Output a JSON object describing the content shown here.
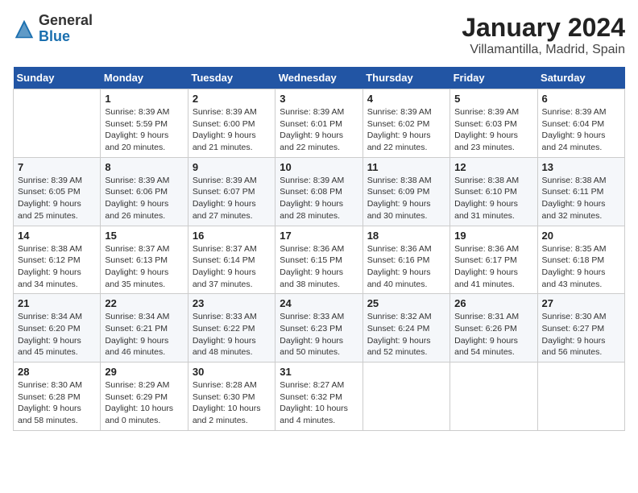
{
  "header": {
    "logo_general": "General",
    "logo_blue": "Blue",
    "month": "January 2024",
    "location": "Villamantilla, Madrid, Spain"
  },
  "weekdays": [
    "Sunday",
    "Monday",
    "Tuesday",
    "Wednesday",
    "Thursday",
    "Friday",
    "Saturday"
  ],
  "weeks": [
    [
      {
        "day": "",
        "empty": true
      },
      {
        "day": "1",
        "sunrise": "Sunrise: 8:39 AM",
        "sunset": "Sunset: 5:59 PM",
        "daylight": "Daylight: 9 hours and 20 minutes."
      },
      {
        "day": "2",
        "sunrise": "Sunrise: 8:39 AM",
        "sunset": "Sunset: 6:00 PM",
        "daylight": "Daylight: 9 hours and 21 minutes."
      },
      {
        "day": "3",
        "sunrise": "Sunrise: 8:39 AM",
        "sunset": "Sunset: 6:01 PM",
        "daylight": "Daylight: 9 hours and 22 minutes."
      },
      {
        "day": "4",
        "sunrise": "Sunrise: 8:39 AM",
        "sunset": "Sunset: 6:02 PM",
        "daylight": "Daylight: 9 hours and 22 minutes."
      },
      {
        "day": "5",
        "sunrise": "Sunrise: 8:39 AM",
        "sunset": "Sunset: 6:03 PM",
        "daylight": "Daylight: 9 hours and 23 minutes."
      },
      {
        "day": "6",
        "sunrise": "Sunrise: 8:39 AM",
        "sunset": "Sunset: 6:04 PM",
        "daylight": "Daylight: 9 hours and 24 minutes."
      }
    ],
    [
      {
        "day": "7",
        "sunrise": "Sunrise: 8:39 AM",
        "sunset": "Sunset: 6:05 PM",
        "daylight": "Daylight: 9 hours and 25 minutes."
      },
      {
        "day": "8",
        "sunrise": "Sunrise: 8:39 AM",
        "sunset": "Sunset: 6:06 PM",
        "daylight": "Daylight: 9 hours and 26 minutes."
      },
      {
        "day": "9",
        "sunrise": "Sunrise: 8:39 AM",
        "sunset": "Sunset: 6:07 PM",
        "daylight": "Daylight: 9 hours and 27 minutes."
      },
      {
        "day": "10",
        "sunrise": "Sunrise: 8:39 AM",
        "sunset": "Sunset: 6:08 PM",
        "daylight": "Daylight: 9 hours and 28 minutes."
      },
      {
        "day": "11",
        "sunrise": "Sunrise: 8:38 AM",
        "sunset": "Sunset: 6:09 PM",
        "daylight": "Daylight: 9 hours and 30 minutes."
      },
      {
        "day": "12",
        "sunrise": "Sunrise: 8:38 AM",
        "sunset": "Sunset: 6:10 PM",
        "daylight": "Daylight: 9 hours and 31 minutes."
      },
      {
        "day": "13",
        "sunrise": "Sunrise: 8:38 AM",
        "sunset": "Sunset: 6:11 PM",
        "daylight": "Daylight: 9 hours and 32 minutes."
      }
    ],
    [
      {
        "day": "14",
        "sunrise": "Sunrise: 8:38 AM",
        "sunset": "Sunset: 6:12 PM",
        "daylight": "Daylight: 9 hours and 34 minutes."
      },
      {
        "day": "15",
        "sunrise": "Sunrise: 8:37 AM",
        "sunset": "Sunset: 6:13 PM",
        "daylight": "Daylight: 9 hours and 35 minutes."
      },
      {
        "day": "16",
        "sunrise": "Sunrise: 8:37 AM",
        "sunset": "Sunset: 6:14 PM",
        "daylight": "Daylight: 9 hours and 37 minutes."
      },
      {
        "day": "17",
        "sunrise": "Sunrise: 8:36 AM",
        "sunset": "Sunset: 6:15 PM",
        "daylight": "Daylight: 9 hours and 38 minutes."
      },
      {
        "day": "18",
        "sunrise": "Sunrise: 8:36 AM",
        "sunset": "Sunset: 6:16 PM",
        "daylight": "Daylight: 9 hours and 40 minutes."
      },
      {
        "day": "19",
        "sunrise": "Sunrise: 8:36 AM",
        "sunset": "Sunset: 6:17 PM",
        "daylight": "Daylight: 9 hours and 41 minutes."
      },
      {
        "day": "20",
        "sunrise": "Sunrise: 8:35 AM",
        "sunset": "Sunset: 6:18 PM",
        "daylight": "Daylight: 9 hours and 43 minutes."
      }
    ],
    [
      {
        "day": "21",
        "sunrise": "Sunrise: 8:34 AM",
        "sunset": "Sunset: 6:20 PM",
        "daylight": "Daylight: 9 hours and 45 minutes."
      },
      {
        "day": "22",
        "sunrise": "Sunrise: 8:34 AM",
        "sunset": "Sunset: 6:21 PM",
        "daylight": "Daylight: 9 hours and 46 minutes."
      },
      {
        "day": "23",
        "sunrise": "Sunrise: 8:33 AM",
        "sunset": "Sunset: 6:22 PM",
        "daylight": "Daylight: 9 hours and 48 minutes."
      },
      {
        "day": "24",
        "sunrise": "Sunrise: 8:33 AM",
        "sunset": "Sunset: 6:23 PM",
        "daylight": "Daylight: 9 hours and 50 minutes."
      },
      {
        "day": "25",
        "sunrise": "Sunrise: 8:32 AM",
        "sunset": "Sunset: 6:24 PM",
        "daylight": "Daylight: 9 hours and 52 minutes."
      },
      {
        "day": "26",
        "sunrise": "Sunrise: 8:31 AM",
        "sunset": "Sunset: 6:26 PM",
        "daylight": "Daylight: 9 hours and 54 minutes."
      },
      {
        "day": "27",
        "sunrise": "Sunrise: 8:30 AM",
        "sunset": "Sunset: 6:27 PM",
        "daylight": "Daylight: 9 hours and 56 minutes."
      }
    ],
    [
      {
        "day": "28",
        "sunrise": "Sunrise: 8:30 AM",
        "sunset": "Sunset: 6:28 PM",
        "daylight": "Daylight: 9 hours and 58 minutes."
      },
      {
        "day": "29",
        "sunrise": "Sunrise: 8:29 AM",
        "sunset": "Sunset: 6:29 PM",
        "daylight": "Daylight: 10 hours and 0 minutes."
      },
      {
        "day": "30",
        "sunrise": "Sunrise: 8:28 AM",
        "sunset": "Sunset: 6:30 PM",
        "daylight": "Daylight: 10 hours and 2 minutes."
      },
      {
        "day": "31",
        "sunrise": "Sunrise: 8:27 AM",
        "sunset": "Sunset: 6:32 PM",
        "daylight": "Daylight: 10 hours and 4 minutes."
      },
      {
        "day": "",
        "empty": true
      },
      {
        "day": "",
        "empty": true
      },
      {
        "day": "",
        "empty": true
      }
    ]
  ]
}
